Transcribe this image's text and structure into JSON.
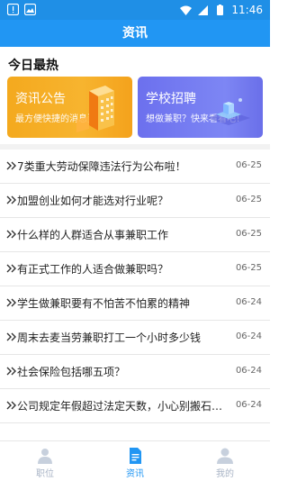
{
  "status": {
    "time": "11:46"
  },
  "appbar": {
    "title": "资讯"
  },
  "section": {
    "title": "今日最热"
  },
  "cards": [
    {
      "title": "资讯公告",
      "subtitle": "最方便快捷的消息资讯"
    },
    {
      "title": "学校招聘",
      "subtitle": "想做兼职？快来看看吧！"
    }
  ],
  "articles": [
    {
      "title": "7类重大劳动保障违法行为公布啦！",
      "date": "06-25"
    },
    {
      "title": "加盟创业如何才能选对行业呢？",
      "date": "06-25"
    },
    {
      "title": "什么样的人群适合从事兼职工作",
      "date": "06-25"
    },
    {
      "title": "有正式工作的人适合做兼职吗？",
      "date": "06-25"
    },
    {
      "title": "学生做兼职要有不怕苦不怕累的精神",
      "date": "06-24"
    },
    {
      "title": "周末去麦当劳兼职打工一个小时多少钱",
      "date": "06-24"
    },
    {
      "title": "社会保险包括哪五项？",
      "date": "06-24"
    },
    {
      "title": "公司规定年假超过法定天数，小心别搬石…",
      "date": "06-24"
    }
  ],
  "tabs": [
    {
      "label": "职位",
      "icon": "person-icon",
      "active": false
    },
    {
      "label": "资讯",
      "icon": "document-icon",
      "active": true
    },
    {
      "label": "我的",
      "icon": "profile-icon",
      "active": false
    }
  ],
  "colors": {
    "primary": "#2196f3",
    "status": "#1f8fe6",
    "news": "#f4a91e",
    "job": "#6c70ee"
  }
}
